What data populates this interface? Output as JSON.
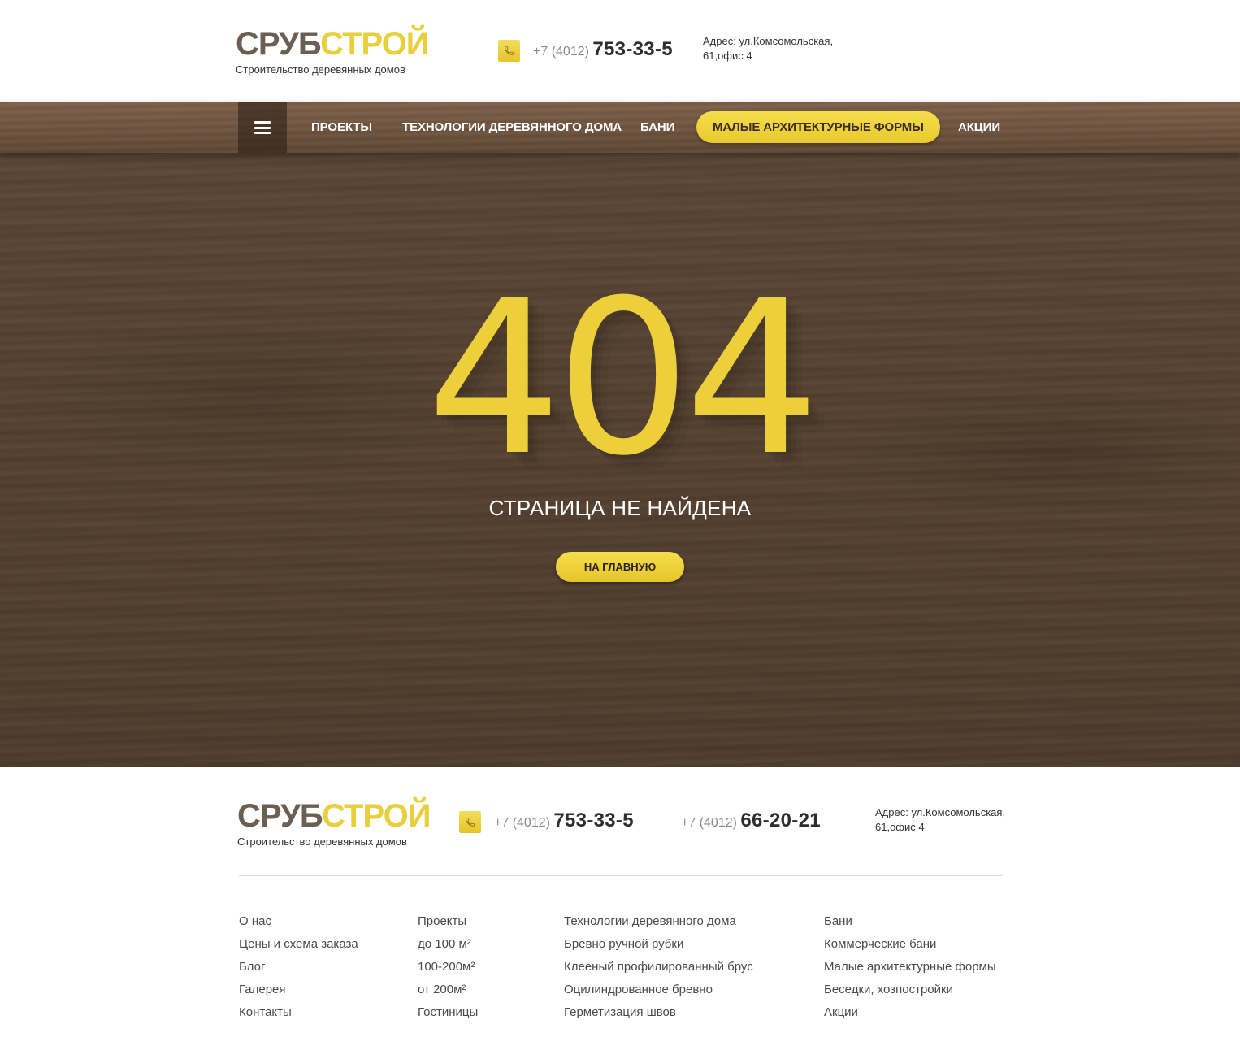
{
  "brand": {
    "name_part1": "СРУБ",
    "name_part2": "СТРОЙ",
    "tagline": "Строительство деревянных домов"
  },
  "header": {
    "phone": {
      "code": "+7 (4012)",
      "number": "753-33-5"
    },
    "address_line1": "Адрес: ул.Комсомольская,",
    "address_line2": "61,офис 4"
  },
  "nav": {
    "items": [
      {
        "label": "ПРОЕКТЫ"
      },
      {
        "label": "ТЕХНОЛОГИИ ДЕРЕВЯННОГО ДОМА"
      },
      {
        "label": "БАНИ"
      },
      {
        "label": "МАЛЫЕ АРХИТЕКТУРНЫЕ ФОРМЫ",
        "active": true
      },
      {
        "label": "АКЦИИ"
      }
    ]
  },
  "error": {
    "code": "404",
    "message": "СТРАНИЦА НЕ НАЙДЕНА",
    "button_label": "НА ГЛАВНУЮ"
  },
  "footer": {
    "phone1": {
      "code": "+7 (4012)",
      "number": "753-33-5"
    },
    "phone2": {
      "code": "+7 (4012)",
      "number": "66-20-21"
    },
    "address_line1": "Адрес: ул.Комсомольская,",
    "address_line2": "61,офис 4",
    "columns": [
      [
        "О нас",
        "Цены и схема заказа",
        "Блог",
        "Галерея",
        "Контакты"
      ],
      [
        "Проекты",
        "до 100 м²",
        "100-200м²",
        "от 200м²",
        "Гостиницы"
      ],
      [
        "Технологии деревянного дома",
        "Бревно ручной рубки",
        "Клееный профилированный брус",
        "Оцилиндрованное бревно",
        "Герметизация швов"
      ],
      [
        "Бани",
        "Коммерческие бани",
        "Малые архитектурные формы",
        "Беседки, хозпостройки",
        "Акции"
      ]
    ]
  },
  "colors": {
    "accent": "#eccf3a",
    "brand_dark": "#6b5e53",
    "wood": "#55412f"
  },
  "icons": {
    "phone": "phone-icon",
    "menu": "hamburger-icon"
  }
}
